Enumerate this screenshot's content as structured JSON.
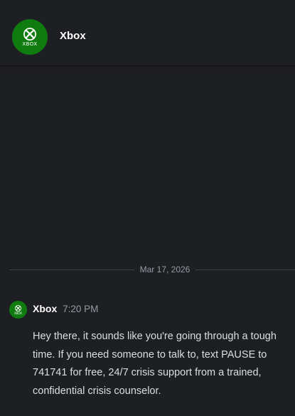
{
  "channel": {
    "name": "Xbox",
    "avatar_text": "XBOX",
    "avatar_color": "#107c10"
  },
  "date_divider": "Mar 17, 2026",
  "message": {
    "author": "Xbox",
    "time": "7:20 PM",
    "avatar_text": "XBOX",
    "text": "Hey there, it sounds like you're going through a tough time. If you need someone to talk to, text PAUSE to 741741 for free, 24/7 crisis support from a trained, confidential crisis counselor."
  },
  "colors": {
    "background": "#1e1f22",
    "text": "#dbdee1",
    "muted": "#949ba4",
    "accent": "#107c10"
  },
  "icons": {
    "avatar": "xbox-logo-icon"
  }
}
